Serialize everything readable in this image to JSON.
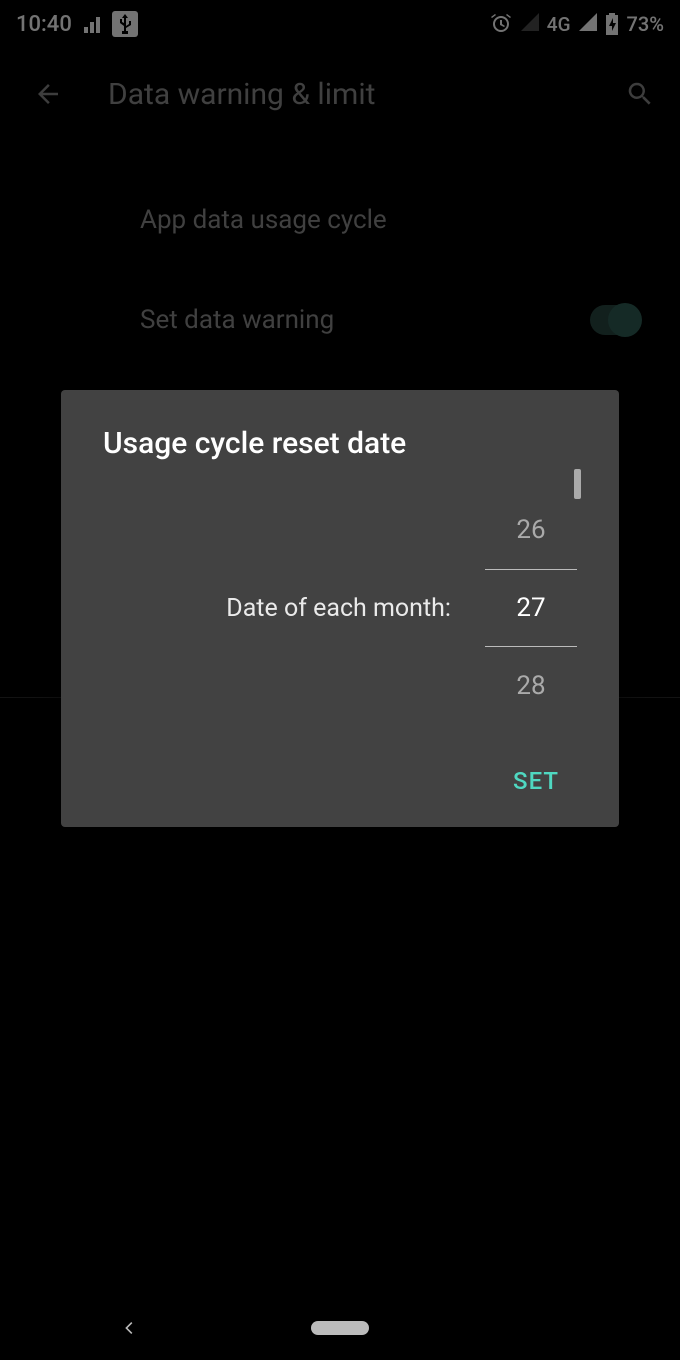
{
  "status": {
    "time": "10:40",
    "network_label": "4G",
    "battery_text": "73%"
  },
  "header": {
    "title": "Data warning & limit"
  },
  "settings": {
    "app_data_usage_cycle": "App data usage cycle",
    "set_data_warning": "Set data warning",
    "set_data_warning_on": true
  },
  "dialog": {
    "title": "Usage cycle reset date",
    "label": "Date of each month:",
    "picker": {
      "prev": "26",
      "selected": "27",
      "next": "28"
    },
    "action": "SET"
  }
}
